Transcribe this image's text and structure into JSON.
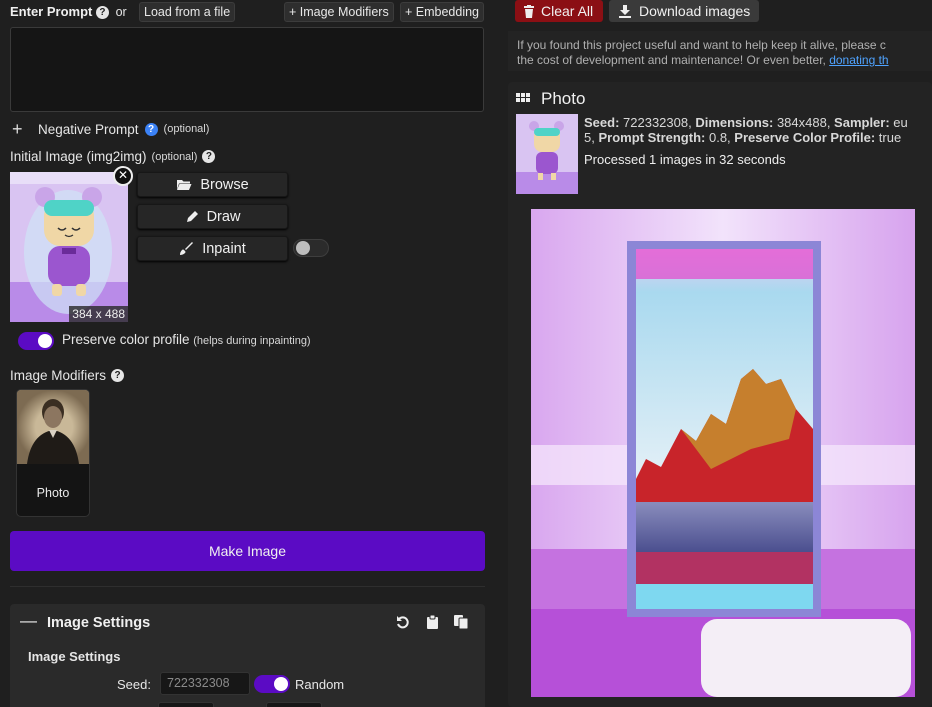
{
  "prompt": {
    "label": "Enter Prompt",
    "or": "or",
    "load_file": "Load from a file",
    "image_modifiers_btn": "+ Image Modifiers",
    "embedding_btn": "+ Embedding",
    "value": ""
  },
  "negative_prompt": {
    "plus": "+",
    "label": "Negative Prompt",
    "optional": "(optional)"
  },
  "init_image": {
    "label": "Initial Image (img2img)",
    "optional": "(optional)",
    "size": "384 x 488",
    "browse": "Browse",
    "draw": "Draw",
    "inpaint": "Inpaint",
    "inpaint_toggle_on": false
  },
  "preserve": {
    "label": "Preserve color profile",
    "hint": "(helps during inpainting)",
    "on": true
  },
  "modifiers": {
    "label": "Image Modifiers",
    "card_label": "Photo"
  },
  "make_image": "Make Image",
  "settings": {
    "minus": "—",
    "title": "Image Settings",
    "sub_title": "Image Settings",
    "seed_label": "Seed:",
    "seed_value": "722332308",
    "random_label": "Random",
    "random_on": true
  },
  "top_actions": {
    "clear_all": "Clear All",
    "download": "Download images"
  },
  "note": {
    "line1": "If you found this project useful and want to help keep it alive, please c",
    "line2": "the cost of development and maintenance! Or even better, ",
    "link": "donating th"
  },
  "result": {
    "title": "Photo",
    "seed_label": "Seed:",
    "seed_value": " 722332308, ",
    "dims_label": "Dimensions:",
    "dims_value": " 384x488, ",
    "sampler_label": "Sampler:",
    "sampler_value": " eu",
    "line2_prefix": "5, ",
    "strength_label": "Prompt Strength:",
    "strength_value": " 0.8, ",
    "preserve_label": "Preserve Color Profile:",
    "preserve_value": " true",
    "processed": "Processed 1 images in 32 seconds"
  },
  "colors": {
    "accent": "#5b0bc4",
    "danger": "#8b0f14"
  }
}
